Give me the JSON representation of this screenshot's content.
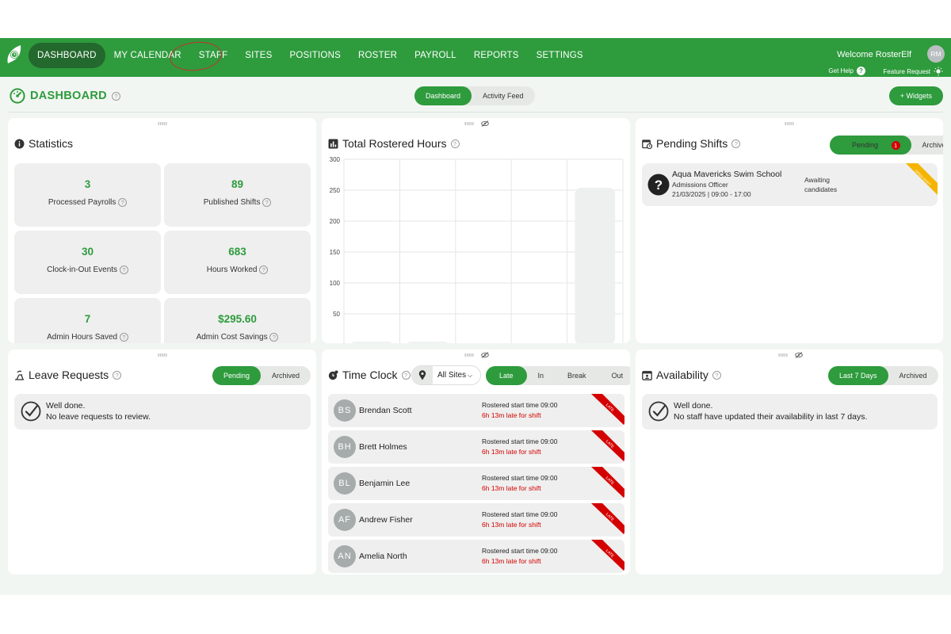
{
  "nav": {
    "items": [
      "DASHBOARD",
      "MY CALENDAR",
      "STAFF",
      "SITES",
      "POSITIONS",
      "ROSTER",
      "PAYROLL",
      "REPORTS",
      "SETTINGS"
    ],
    "welcome": "Welcome RosterElf",
    "avatar": "RM",
    "get_help": "Get Help",
    "feature_request": "Feature Request"
  },
  "header": {
    "title": "DASHBOARD",
    "tabs": [
      "Dashboard",
      "Activity Feed"
    ],
    "widgets_button": "+ Widgets"
  },
  "statistics": {
    "title": "Statistics",
    "items": [
      {
        "value": "3",
        "label": "Processed Payrolls"
      },
      {
        "value": "89",
        "label": "Published Shifts"
      },
      {
        "value": "30",
        "label": "Clock-in-Out Events"
      },
      {
        "value": "683",
        "label": "Hours Worked"
      },
      {
        "value": "7",
        "label": "Admin Hours Saved"
      },
      {
        "value": "$295.60",
        "label": "Admin Cost Savings"
      }
    ]
  },
  "rostered": {
    "title": "Total Rostered Hours"
  },
  "chart_data": {
    "type": "bar",
    "title": "Total Rostered Hours",
    "ylim": [
      0,
      300
    ],
    "yticks": [
      "300",
      "250",
      "200",
      "150",
      "100",
      "50"
    ],
    "values": [
      5,
      5,
      1,
      0,
      254
    ],
    "bar_color": "#eef0ef"
  },
  "pending_shifts": {
    "title": "Pending Shifts",
    "tabs": [
      "Pending",
      "Archived"
    ],
    "badge": "1",
    "item": {
      "site": "Aqua Mavericks Swim School",
      "position": "Admissions Officer",
      "when": "21/03/2025 | 09:00 - 17:00",
      "status_line1": "Awaiting",
      "status_line2": "candidates",
      "ribbon": "OPEN SHIFT"
    }
  },
  "leave": {
    "title": "Leave Requests",
    "tabs": [
      "Pending",
      "Archived"
    ],
    "note_title": "Well done.",
    "note_text": "No leave requests to review."
  },
  "timeclock": {
    "title": "Time Clock",
    "site_filter": "All Sites",
    "tabs": [
      "Late",
      "In",
      "Break",
      "Out"
    ],
    "ribbon": "LATE",
    "rows": [
      {
        "initials": "BS",
        "name": "Brendan Scott",
        "line1": "Rostered start time 09:00",
        "line2": "6h 13m late for shift"
      },
      {
        "initials": "BH",
        "name": "Brett Holmes",
        "line1": "Rostered start time 09:00",
        "line2": "6h 13m late for shift"
      },
      {
        "initials": "BL",
        "name": "Benjamin Lee",
        "line1": "Rostered start time 09:00",
        "line2": "6h 13m late for shift"
      },
      {
        "initials": "AF",
        "name": "Andrew Fisher",
        "line1": "Rostered start time 09:00",
        "line2": "6h 13m late for shift"
      },
      {
        "initials": "AN",
        "name": "Amelia North",
        "line1": "Rostered start time 09:00",
        "line2": "6h 13m late for shift"
      }
    ]
  },
  "availability": {
    "title": "Availability",
    "tabs": [
      "Last 7 Days",
      "Archived"
    ],
    "note_title": "Well done.",
    "note_text": "No staff have updated their availability in last 7 days."
  },
  "colors": {
    "brand": "#2e9b3d",
    "brand_dark": "#23682c",
    "late": "#d40000",
    "ribbon_open": "#f4b400"
  }
}
